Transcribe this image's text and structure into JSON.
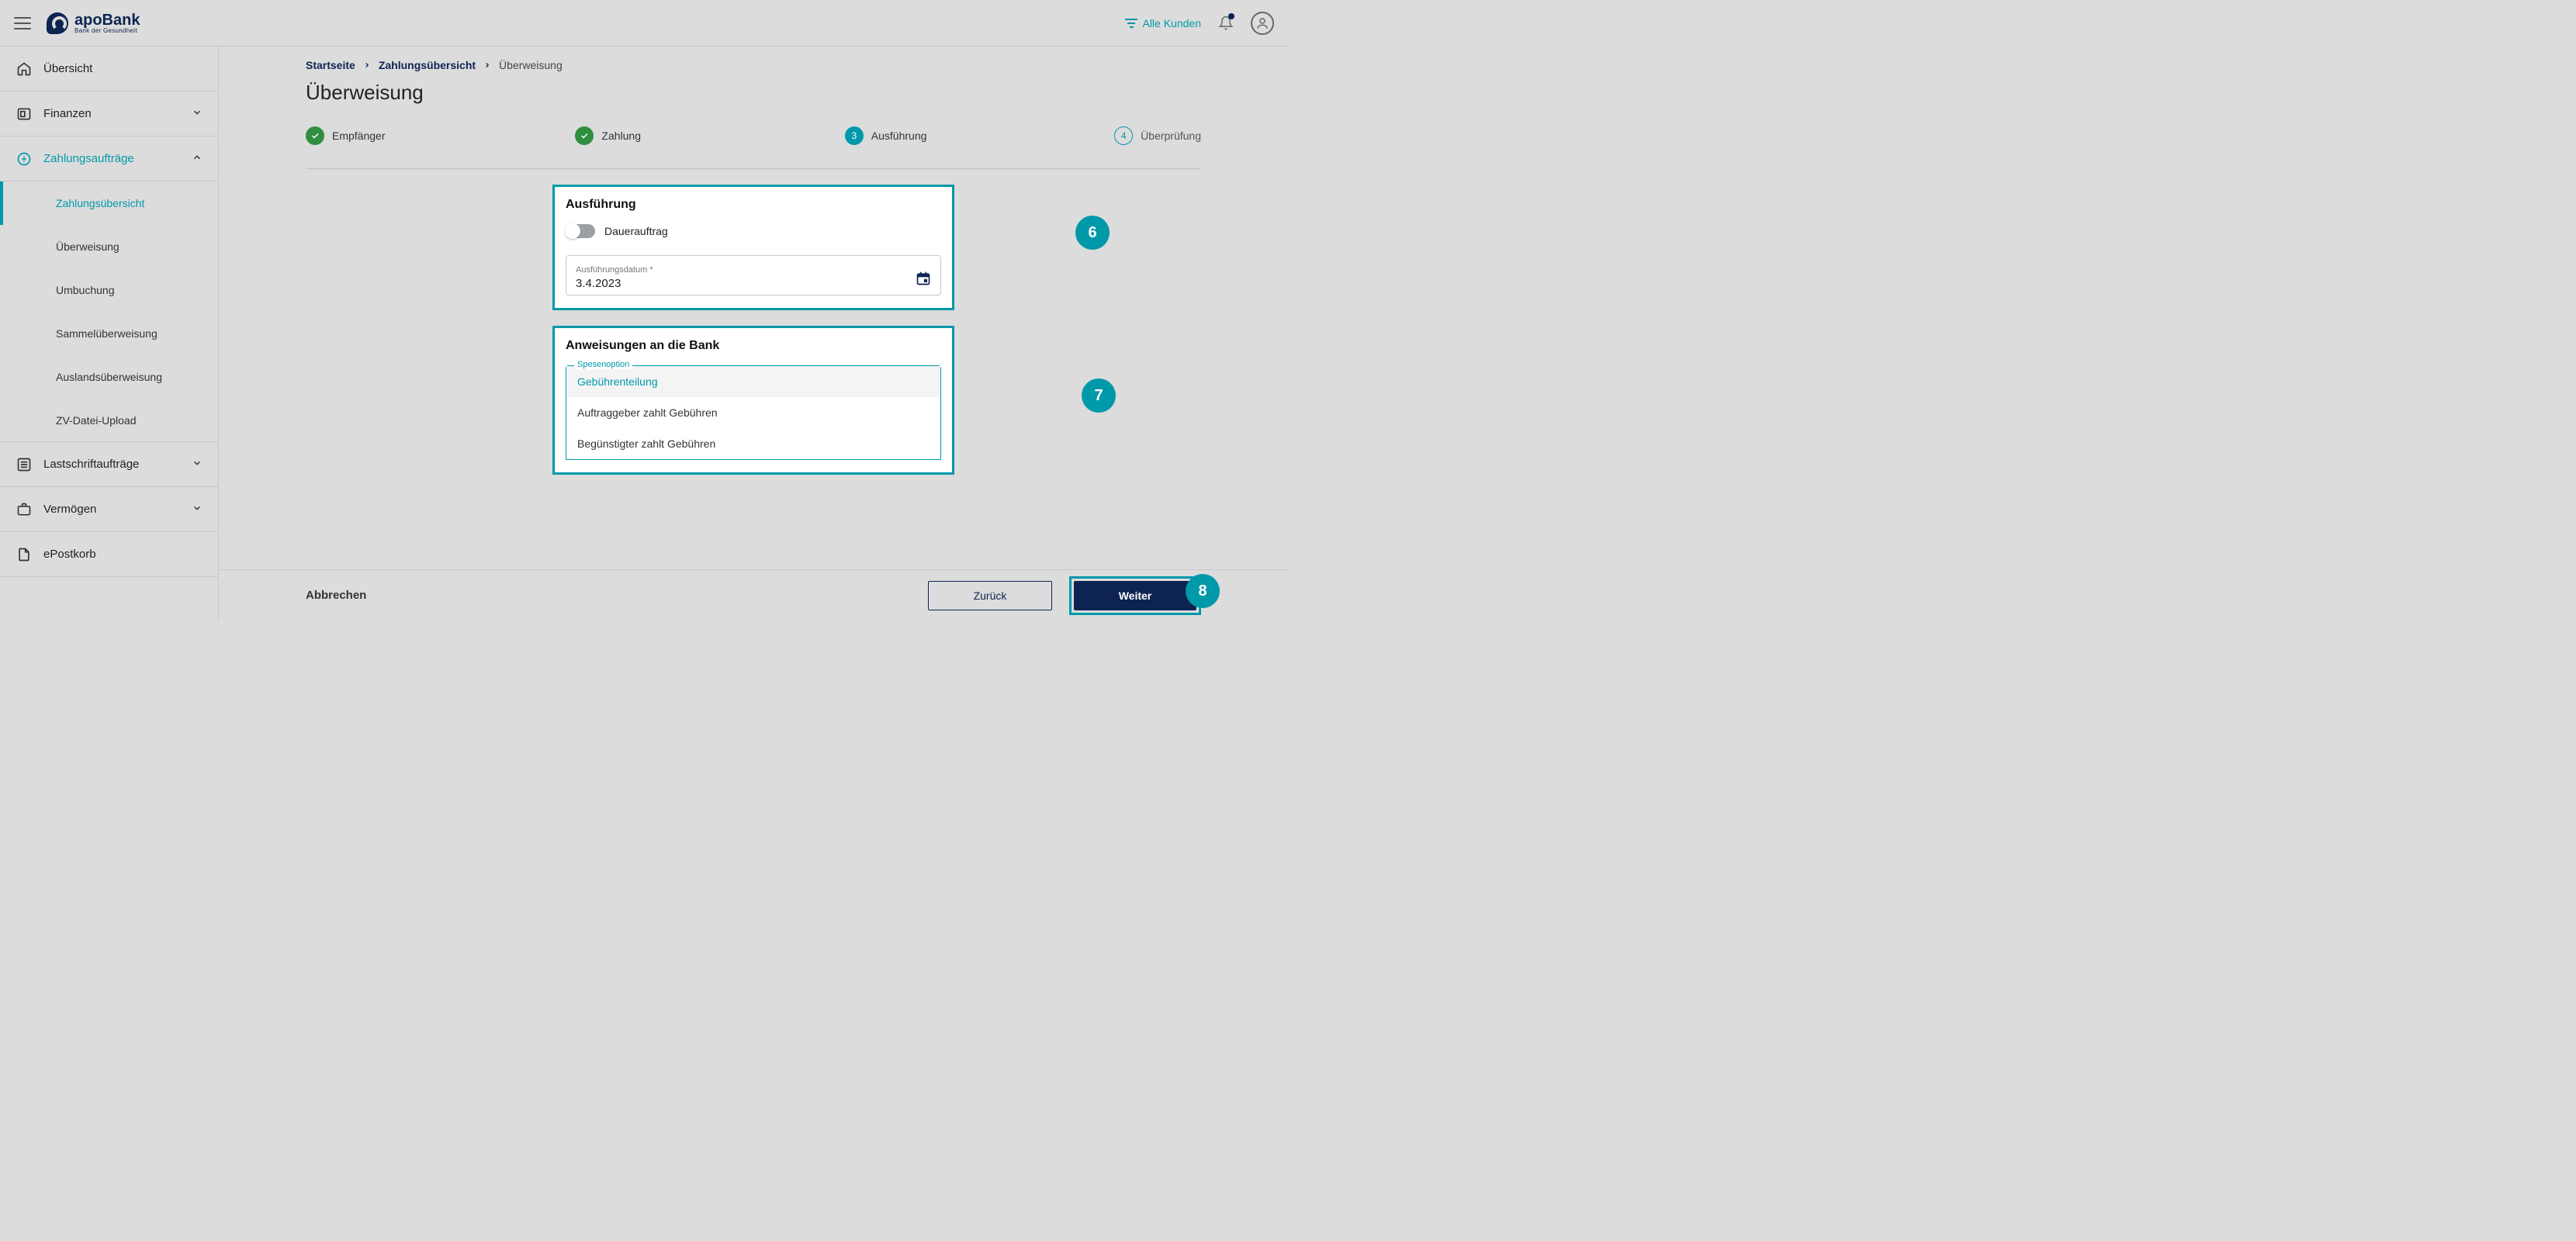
{
  "header": {
    "brand_main": "apoBank",
    "brand_sub": "Bank der Gesundheit",
    "filter_label": "Alle Kunden"
  },
  "sidebar": {
    "items": [
      {
        "label": "Übersicht"
      },
      {
        "label": "Finanzen"
      },
      {
        "label": "Zahlungsaufträge"
      },
      {
        "label": "Lastschriftaufträge"
      },
      {
        "label": "Vermögen"
      },
      {
        "label": "ePostkorb"
      }
    ],
    "sub": [
      {
        "label": "Zahlungsübersicht"
      },
      {
        "label": "Überweisung"
      },
      {
        "label": "Umbuchung"
      },
      {
        "label": "Sammelüberweisung"
      },
      {
        "label": "Auslandsüberweisung"
      },
      {
        "label": "ZV-Datei-Upload"
      }
    ]
  },
  "breadcrumb": {
    "a": "Startseite",
    "b": "Zahlungsübersicht",
    "c": "Überweisung"
  },
  "page_title": "Überweisung",
  "steps": {
    "s1": "Empfänger",
    "s2": "Zahlung",
    "s3": "Ausführung",
    "s4": "Überprüfung",
    "n3": "3",
    "n4": "4"
  },
  "card1": {
    "title": "Ausführung",
    "toggle_label": "Dauerauftrag",
    "date_label": "Ausführungsdatum *",
    "date_value": "3.4.2023"
  },
  "card2": {
    "title": "Anweisungen an die Bank",
    "select_label": "Spesenoption",
    "opt1": "Gebührenteilung",
    "opt2": "Auftraggeber zahlt Gebühren",
    "opt3": "Begünstigter zahlt Gebühren"
  },
  "callouts": {
    "a": "6",
    "b": "7",
    "c": "8"
  },
  "footer": {
    "cancel": "Abbrechen",
    "back": "Zurück",
    "next": "Weiter"
  }
}
